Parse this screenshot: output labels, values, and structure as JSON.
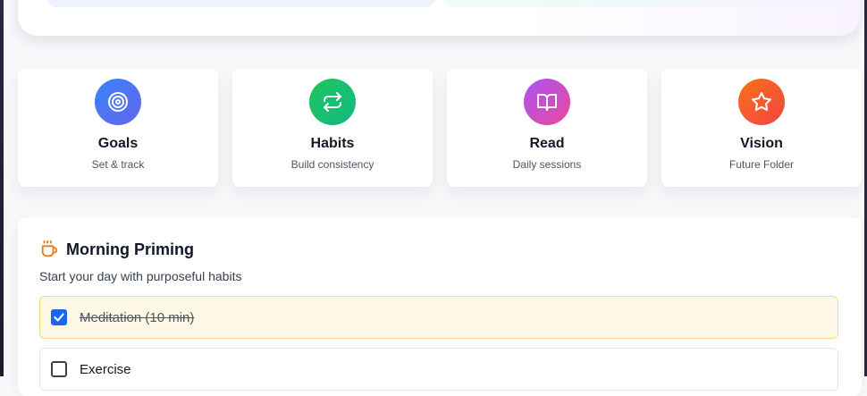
{
  "quick_actions": [
    {
      "title": "Goals",
      "subtitle": "Set & track",
      "icon": "target-icon",
      "color": "#4f6ef7"
    },
    {
      "title": "Habits",
      "subtitle": "Build consistency",
      "icon": "repeat-icon",
      "color": "#22c55e"
    },
    {
      "title": "Read",
      "subtitle": "Daily sessions",
      "icon": "book-open-icon",
      "color": "#c55ae8"
    },
    {
      "title": "Vision",
      "subtitle": "Future Folder",
      "icon": "star-icon",
      "color": "#f4553b"
    }
  ],
  "morning_priming": {
    "title": "Morning Priming",
    "icon": "coffee-cup-icon",
    "description": "Start your day with purposeful habits",
    "habits": [
      {
        "label": "Meditation (10 min)",
        "checked": true
      },
      {
        "label": "Exercise",
        "checked": false
      }
    ]
  },
  "colors": {
    "accent_orange": "#ea7a1d",
    "checkbox_blue": "#1c64f2",
    "done_background": "#fef9e7",
    "done_border": "#f3dc84"
  }
}
